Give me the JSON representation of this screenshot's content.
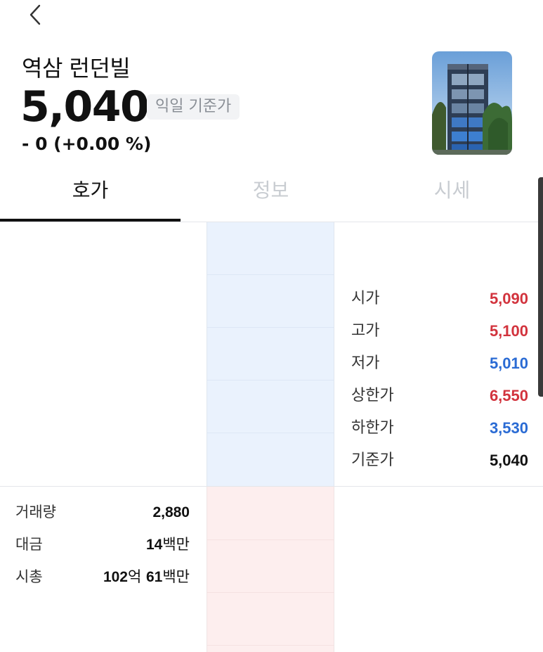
{
  "header": {
    "back_icon": "chevron-left-icon",
    "title": "역삼 런던빌",
    "price": "5,040",
    "price_badge": "익일 기준가",
    "change": "- 0 (+0.00 %)"
  },
  "tabs": [
    {
      "label": "호가",
      "active": true
    },
    {
      "label": "정보",
      "active": false
    },
    {
      "label": "시세",
      "active": false
    }
  ],
  "price_info": [
    {
      "label": "시가",
      "value": "5,090",
      "color": "#d2333d"
    },
    {
      "label": "고가",
      "value": "5,100",
      "color": "#d2333d"
    },
    {
      "label": "저가",
      "value": "5,010",
      "color": "#2a6bd4"
    },
    {
      "label": "상한가",
      "value": "6,550",
      "color": "#d2333d"
    },
    {
      "label": "하한가",
      "value": "3,530",
      "color": "#2a6bd4"
    },
    {
      "label": "기준가",
      "value": "5,040",
      "color": "#111111"
    }
  ],
  "trade_stats": {
    "volume": {
      "label": "거래량",
      "num": "2,880"
    },
    "amount": {
      "label": "대금",
      "num": "14",
      "unit": "백만"
    },
    "market_cap": {
      "label": "시총",
      "num1": "102",
      "unit1": "억 ",
      "num2": "61",
      "unit2": "백만"
    }
  },
  "colors": {
    "up": "#d2333d",
    "down": "#2a6bd4",
    "ask_bg": "#eaf2fd",
    "bid_bg": "#fdeeee"
  }
}
